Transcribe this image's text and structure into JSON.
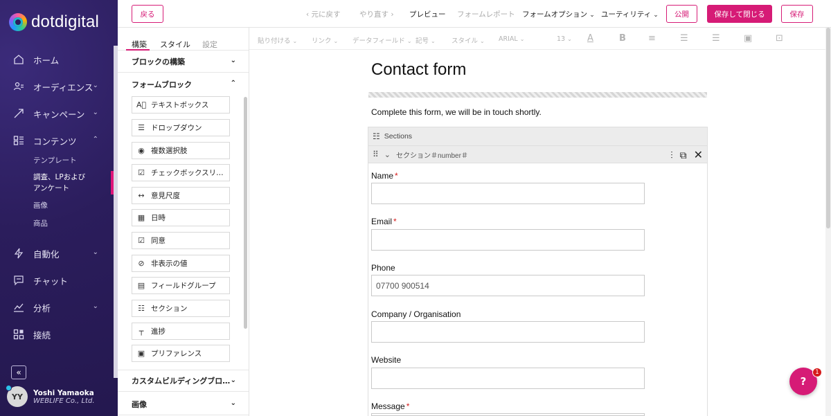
{
  "brand": {
    "name": "dotdigital"
  },
  "nav": {
    "items": [
      {
        "label": "ホーム",
        "icon": "home-icon",
        "chevron": false
      },
      {
        "label": "オーディエンス",
        "icon": "audience-icon",
        "chevron": true
      },
      {
        "label": "キャンペーン",
        "icon": "campaign-icon",
        "chevron": true
      },
      {
        "label": "コンテンツ",
        "icon": "content-icon",
        "chevron": true
      },
      {
        "label": "自動化",
        "icon": "automation-icon",
        "chevron": true
      },
      {
        "label": "チャット",
        "icon": "chat-icon",
        "chevron": false
      },
      {
        "label": "分析",
        "icon": "analytics-icon",
        "chevron": true
      },
      {
        "label": "接続",
        "icon": "connect-icon",
        "chevron": false
      }
    ],
    "content_sub": [
      "テンプレート",
      "調査、LPおよび",
      "アンケート",
      "画像",
      "商品"
    ]
  },
  "user": {
    "initials": "YY",
    "name": "Yoshi Yamaoka",
    "company": "WEBLIFE Co., Ltd."
  },
  "topbar": {
    "back": "戻る",
    "undo": "元に戻す",
    "redo": "やり直す",
    "preview": "プレビュー",
    "form_report": "フォームレポート",
    "form_options": "フォームオプション",
    "utility": "ユーティリティ",
    "publish": "公開",
    "save_close": "保存して閉じる",
    "save": "保存"
  },
  "panel": {
    "tabs": [
      "構築",
      "スタイル",
      "設定"
    ],
    "block_build": "ブロックの構築",
    "form_blocks": "フォームブロック",
    "blocks": [
      {
        "label": "テキストボックス",
        "icon": "textbox-icon"
      },
      {
        "label": "ドロップダウン",
        "icon": "dropdown-icon"
      },
      {
        "label": "複数選択肢",
        "icon": "radio-icon"
      },
      {
        "label": "チェックボックスリ…",
        "icon": "checkbox-list-icon"
      },
      {
        "label": "意見尺度",
        "icon": "scale-icon"
      },
      {
        "label": "日時",
        "icon": "calendar-icon"
      },
      {
        "label": "同意",
        "icon": "consent-icon"
      },
      {
        "label": "非表示の値",
        "icon": "hidden-icon"
      },
      {
        "label": "フィールドグループ",
        "icon": "fieldgroup-icon"
      },
      {
        "label": "セクション",
        "icon": "section-icon"
      },
      {
        "label": "進捗",
        "icon": "progress-icon"
      },
      {
        "label": "プリファレンス",
        "icon": "preference-icon"
      }
    ],
    "custom_blocks": "カスタムビルディングブロ…",
    "images": "画像"
  },
  "toolbar": {
    "paste": "貼り付ける",
    "link": "リンク",
    "data_field": "データフィールド",
    "symbol": "記号",
    "style": "スタイル",
    "font": "ARIAL",
    "size": "13"
  },
  "form": {
    "title": "Contact form",
    "intro": "Complete this form, we will be in touch shortly.",
    "sections_label": "Sections",
    "section_name": "セクション＃number＃",
    "fields": [
      {
        "label": "Name",
        "required": "*",
        "value": ""
      },
      {
        "label": "Email",
        "required": "*",
        "value": ""
      },
      {
        "label": "Phone",
        "required": "",
        "value": "07700 900514"
      },
      {
        "label": "Company / Organisation",
        "required": "",
        "value": ""
      },
      {
        "label": "Website",
        "required": "",
        "value": ""
      },
      {
        "label": "Message",
        "required": "*",
        "value": ""
      }
    ]
  },
  "help": {
    "badge": "1"
  },
  "colors": {
    "accent": "#d61b76",
    "nav_bg": "#2b1d5c"
  }
}
